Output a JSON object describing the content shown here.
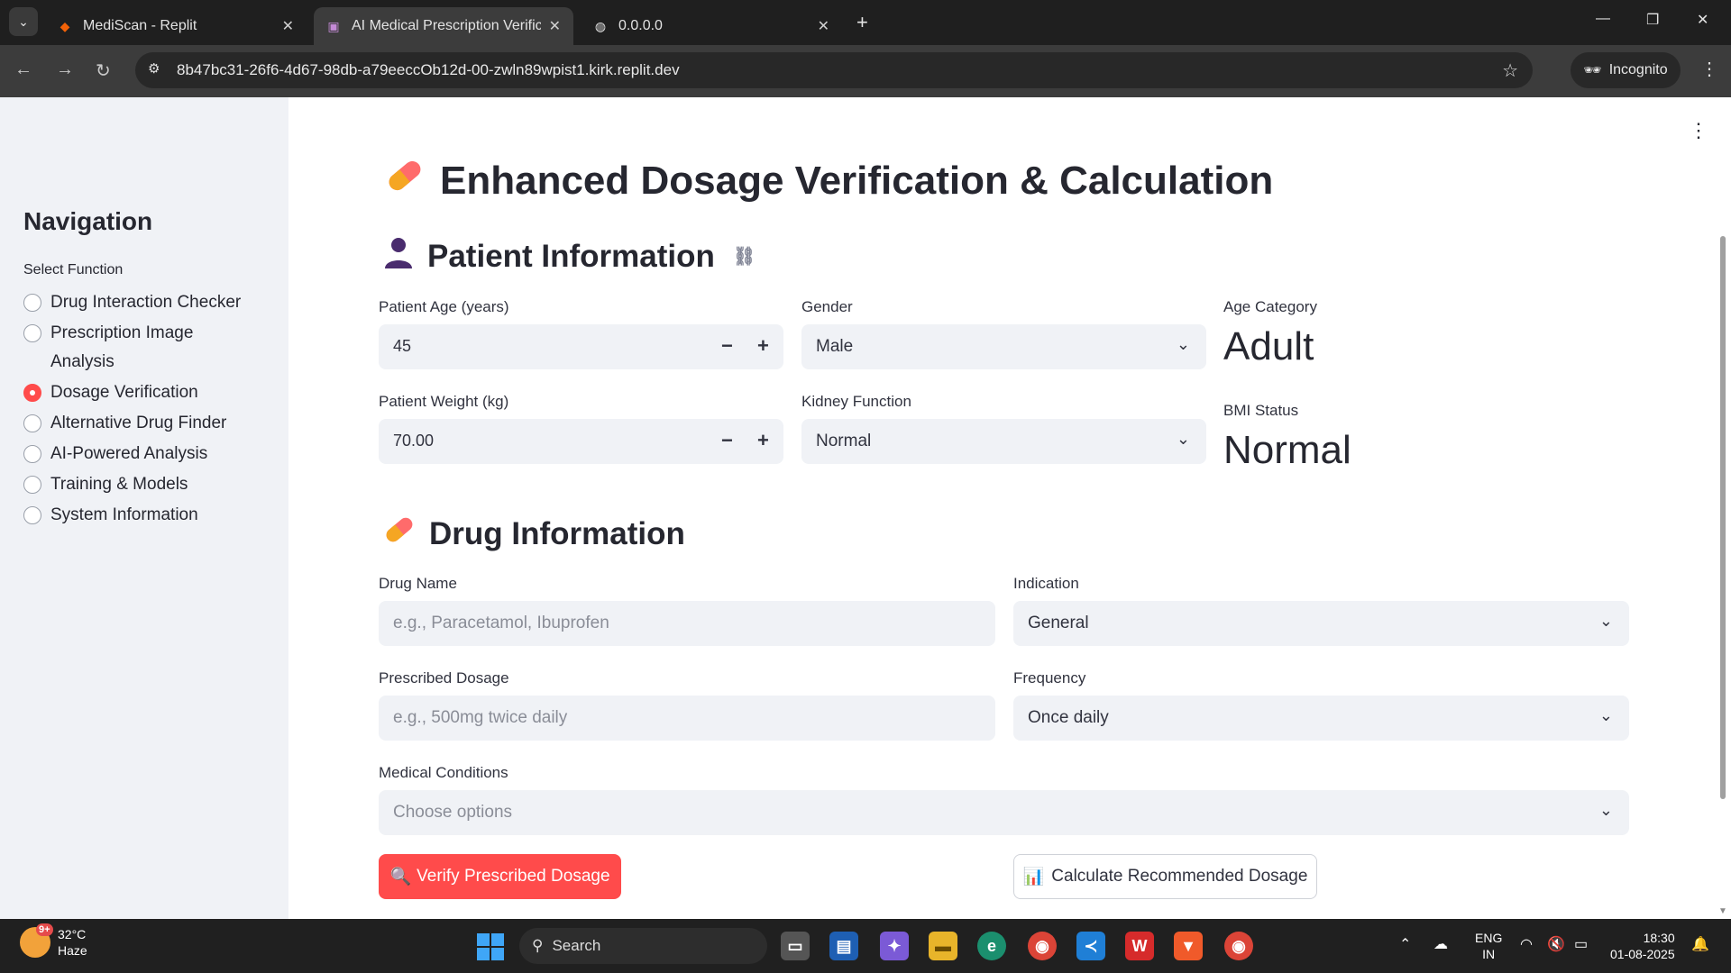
{
  "browser": {
    "tabs": [
      {
        "title": "MediScan - Replit",
        "favicon": "replit-icon"
      },
      {
        "title": "AI Medical Prescription Verificat",
        "favicon": "app-icon"
      },
      {
        "title": "0.0.0.0",
        "favicon": "globe-icon"
      }
    ],
    "url": "8b47bc31-26f6-4d67-98db-a79eeccOb12d-00-zwln89wpist1.kirk.replit.dev",
    "incognito_label": "Incognito"
  },
  "sidebar": {
    "title": "Navigation",
    "select_label": "Select Function",
    "items": [
      {
        "label": "Drug Interaction Checker",
        "selected": false
      },
      {
        "label": "Prescription Image Analysis",
        "selected": false
      },
      {
        "label": "Dosage Verification",
        "selected": true
      },
      {
        "label": "Alternative Drug Finder",
        "selected": false
      },
      {
        "label": "AI-Powered Analysis",
        "selected": false
      },
      {
        "label": "Training & Models",
        "selected": false
      },
      {
        "label": "System Information",
        "selected": false
      }
    ]
  },
  "page": {
    "title": "Enhanced Dosage Verification & Calculation",
    "patient_section": "Patient Information",
    "age_label": "Patient Age (years)",
    "age_value": "45",
    "weight_label": "Patient Weight (kg)",
    "weight_value": "70.00",
    "gender_label": "Gender",
    "gender_value": "Male",
    "kidney_label": "Kidney Function",
    "kidney_value": "Normal",
    "age_category_label": "Age Category",
    "age_category_value": "Adult",
    "bmi_label": "BMI Status",
    "bmi_value": "Normal",
    "drug_section": "Drug Information",
    "drug_name_label": "Drug Name",
    "drug_name_placeholder": "e.g., Paracetamol, Ibuprofen",
    "indication_label": "Indication",
    "indication_value": "General",
    "dosage_label": "Prescribed Dosage",
    "dosage_placeholder": "e.g., 500mg twice daily",
    "frequency_label": "Frequency",
    "frequency_value": "Once daily",
    "conditions_label": "Medical Conditions",
    "conditions_placeholder": "Choose options",
    "verify_button": "Verify Prescribed Dosage",
    "calculate_button": "Calculate Recommended Dosage"
  },
  "taskbar": {
    "weather_temp": "32°C",
    "weather_desc": "Haze",
    "weather_badge": "9+",
    "search_label": "Search",
    "lang_top": "ENG",
    "lang_bottom": "IN",
    "time": "18:30",
    "date": "01-08-2025"
  },
  "colors": {
    "accent": "#ff4b4b",
    "sidebar_bg": "#f0f2f6",
    "text": "#262730"
  }
}
